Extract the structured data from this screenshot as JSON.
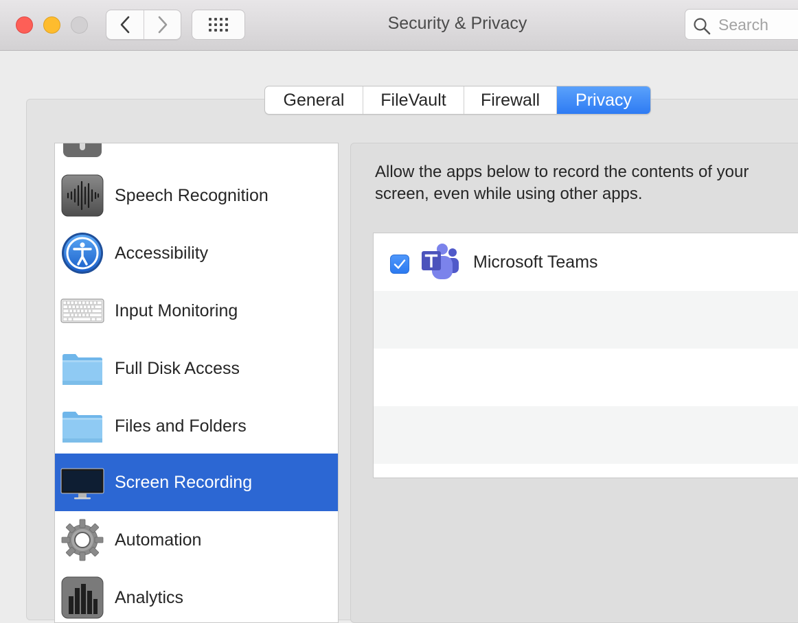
{
  "window": {
    "title": "Security & Privacy",
    "search": {
      "placeholder": "Search",
      "value": ""
    }
  },
  "tabs": [
    {
      "label": "General",
      "active": false
    },
    {
      "label": "FileVault",
      "active": false
    },
    {
      "label": "Firewall",
      "active": false
    },
    {
      "label": "Privacy",
      "active": true
    }
  ],
  "categories": [
    {
      "label": "",
      "icon": "microphone-icon",
      "selected": false
    },
    {
      "label": "Speech Recognition",
      "icon": "waveform-icon",
      "selected": false
    },
    {
      "label": "Accessibility",
      "icon": "accessibility-icon",
      "selected": false
    },
    {
      "label": "Input Monitoring",
      "icon": "keyboard-icon",
      "selected": false
    },
    {
      "label": "Full Disk Access",
      "icon": "folder-icon",
      "selected": false
    },
    {
      "label": "Files and Folders",
      "icon": "folder-icon",
      "selected": false
    },
    {
      "label": "Screen Recording",
      "icon": "display-icon",
      "selected": true
    },
    {
      "label": "Automation",
      "icon": "gear-icon",
      "selected": false
    },
    {
      "label": "Analytics",
      "icon": "bar-chart-icon",
      "selected": false
    }
  ],
  "detail": {
    "description_line1": "Allow the apps below to record the contents of your",
    "description_line2": "screen, even while using other apps.",
    "apps": [
      {
        "name": "Microsoft Teams",
        "checked": true,
        "icon": "microsoft-teams-icon"
      }
    ]
  },
  "colors": {
    "selection": "#2c67d3",
    "tab_active": "#3b86f6",
    "checkbox": "#3a86f5",
    "teams": "#5059c9"
  }
}
